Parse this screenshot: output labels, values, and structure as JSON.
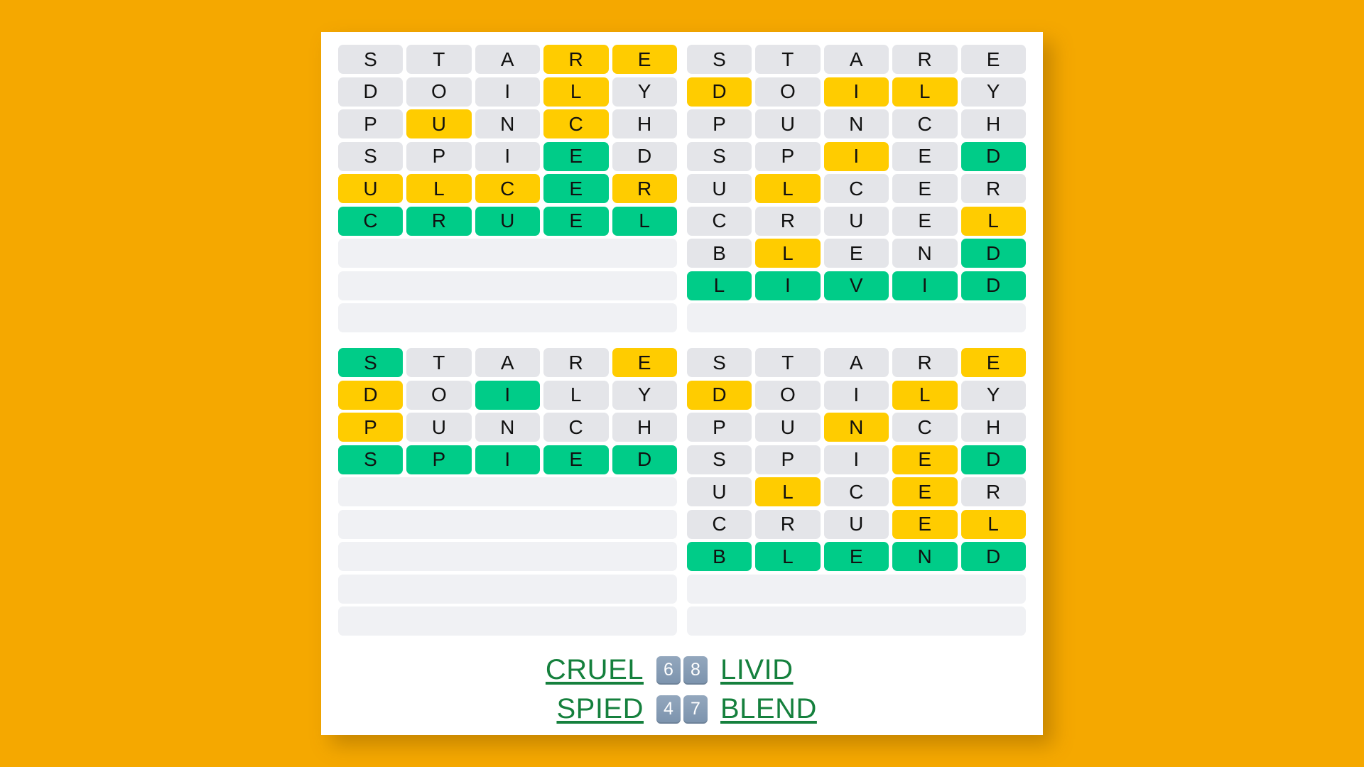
{
  "game": {
    "name": "Quordle",
    "colors": {
      "background": "#f5a800",
      "card": "#ffffff",
      "absent": "#e4e5e9",
      "present": "#ffcc00",
      "correct": "#00cc88",
      "answer_text": "#15803d",
      "badge": "#7c93ad"
    }
  },
  "boards": [
    {
      "id": "board-top-left",
      "answer": "CRUEL",
      "rows_used": 6,
      "rows": [
        {
          "letters": [
            "S",
            "T",
            "A",
            "R",
            "E"
          ],
          "states": [
            "absent",
            "absent",
            "absent",
            "present",
            "present"
          ]
        },
        {
          "letters": [
            "D",
            "O",
            "I",
            "L",
            "Y"
          ],
          "states": [
            "absent",
            "absent",
            "absent",
            "present",
            "absent"
          ]
        },
        {
          "letters": [
            "P",
            "U",
            "N",
            "C",
            "H"
          ],
          "states": [
            "absent",
            "present",
            "absent",
            "present",
            "absent"
          ]
        },
        {
          "letters": [
            "S",
            "P",
            "I",
            "E",
            "D"
          ],
          "states": [
            "absent",
            "absent",
            "absent",
            "correct",
            "absent"
          ]
        },
        {
          "letters": [
            "U",
            "L",
            "C",
            "E",
            "R"
          ],
          "states": [
            "present",
            "present",
            "present",
            "correct",
            "present"
          ]
        },
        {
          "letters": [
            "C",
            "R",
            "U",
            "E",
            "L"
          ],
          "states": [
            "correct",
            "correct",
            "correct",
            "correct",
            "correct"
          ]
        },
        {
          "letters": [
            "",
            "",
            "",
            "",
            ""
          ],
          "states": [
            "blank",
            "blank",
            "blank",
            "blank",
            "blank"
          ]
        },
        {
          "letters": [
            "",
            "",
            "",
            "",
            ""
          ],
          "states": [
            "blank",
            "blank",
            "blank",
            "blank",
            "blank"
          ]
        },
        {
          "letters": [
            "",
            "",
            "",
            "",
            ""
          ],
          "states": [
            "blank",
            "blank",
            "blank",
            "blank",
            "blank"
          ]
        }
      ]
    },
    {
      "id": "board-top-right",
      "answer": "LIVID",
      "rows_used": 8,
      "rows": [
        {
          "letters": [
            "S",
            "T",
            "A",
            "R",
            "E"
          ],
          "states": [
            "absent",
            "absent",
            "absent",
            "absent",
            "absent"
          ]
        },
        {
          "letters": [
            "D",
            "O",
            "I",
            "L",
            "Y"
          ],
          "states": [
            "present",
            "absent",
            "present",
            "present",
            "absent"
          ]
        },
        {
          "letters": [
            "P",
            "U",
            "N",
            "C",
            "H"
          ],
          "states": [
            "absent",
            "absent",
            "absent",
            "absent",
            "absent"
          ]
        },
        {
          "letters": [
            "S",
            "P",
            "I",
            "E",
            "D"
          ],
          "states": [
            "absent",
            "absent",
            "present",
            "absent",
            "correct"
          ]
        },
        {
          "letters": [
            "U",
            "L",
            "C",
            "E",
            "R"
          ],
          "states": [
            "absent",
            "present",
            "absent",
            "absent",
            "absent"
          ]
        },
        {
          "letters": [
            "C",
            "R",
            "U",
            "E",
            "L"
          ],
          "states": [
            "absent",
            "absent",
            "absent",
            "absent",
            "present"
          ]
        },
        {
          "letters": [
            "B",
            "L",
            "E",
            "N",
            "D"
          ],
          "states": [
            "absent",
            "present",
            "absent",
            "absent",
            "correct"
          ]
        },
        {
          "letters": [
            "L",
            "I",
            "V",
            "I",
            "D"
          ],
          "states": [
            "correct",
            "correct",
            "correct",
            "correct",
            "correct"
          ]
        },
        {
          "letters": [
            "",
            "",
            "",
            "",
            ""
          ],
          "states": [
            "blank",
            "blank",
            "blank",
            "blank",
            "blank"
          ]
        }
      ]
    },
    {
      "id": "board-bottom-left",
      "answer": "SPIED",
      "rows_used": 4,
      "rows": [
        {
          "letters": [
            "S",
            "T",
            "A",
            "R",
            "E"
          ],
          "states": [
            "correct",
            "absent",
            "absent",
            "absent",
            "present"
          ]
        },
        {
          "letters": [
            "D",
            "O",
            "I",
            "L",
            "Y"
          ],
          "states": [
            "present",
            "absent",
            "correct",
            "absent",
            "absent"
          ]
        },
        {
          "letters": [
            "P",
            "U",
            "N",
            "C",
            "H"
          ],
          "states": [
            "present",
            "absent",
            "absent",
            "absent",
            "absent"
          ]
        },
        {
          "letters": [
            "S",
            "P",
            "I",
            "E",
            "D"
          ],
          "states": [
            "correct",
            "correct",
            "correct",
            "correct",
            "correct"
          ]
        },
        {
          "letters": [
            "",
            "",
            "",
            "",
            ""
          ],
          "states": [
            "blank",
            "blank",
            "blank",
            "blank",
            "blank"
          ]
        },
        {
          "letters": [
            "",
            "",
            "",
            "",
            ""
          ],
          "states": [
            "blank",
            "blank",
            "blank",
            "blank",
            "blank"
          ]
        },
        {
          "letters": [
            "",
            "",
            "",
            "",
            ""
          ],
          "states": [
            "blank",
            "blank",
            "blank",
            "blank",
            "blank"
          ]
        },
        {
          "letters": [
            "",
            "",
            "",
            "",
            ""
          ],
          "states": [
            "blank",
            "blank",
            "blank",
            "blank",
            "blank"
          ]
        },
        {
          "letters": [
            "",
            "",
            "",
            "",
            ""
          ],
          "states": [
            "blank",
            "blank",
            "blank",
            "blank",
            "blank"
          ]
        }
      ]
    },
    {
      "id": "board-bottom-right",
      "answer": "BLEND",
      "rows_used": 7,
      "rows": [
        {
          "letters": [
            "S",
            "T",
            "A",
            "R",
            "E"
          ],
          "states": [
            "absent",
            "absent",
            "absent",
            "absent",
            "present"
          ]
        },
        {
          "letters": [
            "D",
            "O",
            "I",
            "L",
            "Y"
          ],
          "states": [
            "present",
            "absent",
            "absent",
            "present",
            "absent"
          ]
        },
        {
          "letters": [
            "P",
            "U",
            "N",
            "C",
            "H"
          ],
          "states": [
            "absent",
            "absent",
            "present",
            "absent",
            "absent"
          ]
        },
        {
          "letters": [
            "S",
            "P",
            "I",
            "E",
            "D"
          ],
          "states": [
            "absent",
            "absent",
            "absent",
            "present",
            "correct"
          ]
        },
        {
          "letters": [
            "U",
            "L",
            "C",
            "E",
            "R"
          ],
          "states": [
            "absent",
            "present",
            "absent",
            "present",
            "absent"
          ]
        },
        {
          "letters": [
            "C",
            "R",
            "U",
            "E",
            "L"
          ],
          "states": [
            "absent",
            "absent",
            "absent",
            "present",
            "present"
          ]
        },
        {
          "letters": [
            "B",
            "L",
            "E",
            "N",
            "D"
          ],
          "states": [
            "correct",
            "correct",
            "correct",
            "correct",
            "correct"
          ]
        },
        {
          "letters": [
            "",
            "",
            "",
            "",
            ""
          ],
          "states": [
            "blank",
            "blank",
            "blank",
            "blank",
            "blank"
          ]
        },
        {
          "letters": [
            "",
            "",
            "",
            "",
            ""
          ],
          "states": [
            "blank",
            "blank",
            "blank",
            "blank",
            "blank"
          ]
        }
      ]
    }
  ],
  "answers": {
    "line1": {
      "left_word": "CRUEL",
      "left_score": "6",
      "right_score": "8",
      "right_word": "LIVID"
    },
    "line2": {
      "left_word": "SPIED",
      "left_score": "4",
      "right_score": "7",
      "right_word": "BLEND"
    }
  }
}
